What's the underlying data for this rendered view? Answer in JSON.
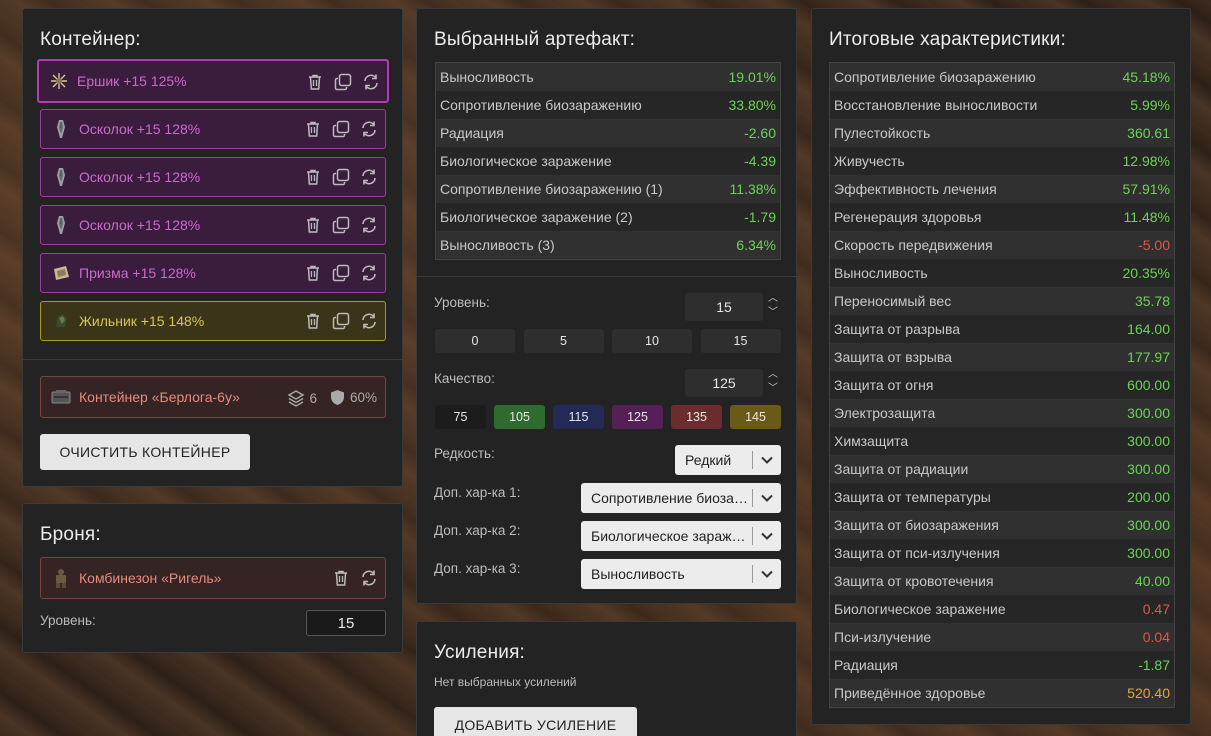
{
  "container": {
    "title": "Контейнер:",
    "slots": [
      {
        "label": "Ершик +15 125%",
        "icon": "erzhik-artifact-icon",
        "color": "purple"
      },
      {
        "label": "Осколок +15 128%",
        "icon": "oskolok-artifact-icon",
        "color": "purple"
      },
      {
        "label": "Осколок +15 128%",
        "icon": "oskolok-artifact-icon",
        "color": "purple"
      },
      {
        "label": "Осколок +15 128%",
        "icon": "oskolok-artifact-icon",
        "color": "purple"
      },
      {
        "label": "Призма +15 128%",
        "icon": "prizma-artifact-icon",
        "color": "purple"
      },
      {
        "label": "Жильник +15 148%",
        "icon": "zhilnik-artifact-icon",
        "color": "yellow"
      }
    ],
    "item": {
      "label": "Контейнер «Берлога-6у»",
      "slots": "6",
      "protection": "60%"
    },
    "clear_button": "ОЧИСТИТЬ КОНТЕЙНЕР"
  },
  "armor": {
    "title": "Броня:",
    "item_label": "Комбинезон «Ригель»",
    "level_label": "Уровень:",
    "level_value": "15"
  },
  "artifact": {
    "title": "Выбранный артефакт:",
    "stats": [
      {
        "name": "Выносливость",
        "value": "19.01%",
        "tone": "pos"
      },
      {
        "name": "Сопротивление биозаражению",
        "value": "33.80%",
        "tone": "pos"
      },
      {
        "name": "Радиация",
        "value": "-2.60",
        "tone": "pos"
      },
      {
        "name": "Биологическое заражение",
        "value": "-4.39",
        "tone": "pos"
      },
      {
        "name": "Сопротивление биозаражению (1)",
        "value": "11.38%",
        "tone": "pos"
      },
      {
        "name": "Биологическое заражение (2)",
        "value": "-1.79",
        "tone": "pos"
      },
      {
        "name": "Выносливость (3)",
        "value": "6.34%",
        "tone": "pos"
      }
    ],
    "level_label": "Уровень:",
    "level_value": "15",
    "level_presets": [
      "0",
      "5",
      "10",
      "15"
    ],
    "quality_label": "Качество:",
    "quality_value": "125",
    "quality_presets": [
      {
        "label": "75",
        "color": "#1c1c1c"
      },
      {
        "label": "105",
        "color": "#2f6b2f"
      },
      {
        "label": "115",
        "color": "#222a55"
      },
      {
        "label": "125",
        "color": "#552055"
      },
      {
        "label": "135",
        "color": "#6a2c2c"
      },
      {
        "label": "145",
        "color": "#6a5a18"
      }
    ],
    "rarity_label": "Редкость:",
    "rarity_value": "Редкий",
    "extra1_label": "Доп. хар-ка 1:",
    "extra1_value": "Сопротивление биозаражению",
    "extra2_label": "Доп. хар-ка 2:",
    "extra2_value": "Биологическое заражение",
    "extra3_label": "Доп. хар-ка 3:",
    "extra3_value": "Выносливость"
  },
  "boosts": {
    "title": "Усиления:",
    "empty_text": "Нет выбранных усилений",
    "add_button": "ДОБАВИТЬ УСИЛЕНИЕ"
  },
  "totals": {
    "title": "Итоговые характеристики:",
    "stats": [
      {
        "name": "Сопротивление биозаражению",
        "value": "45.18%",
        "tone": "pos"
      },
      {
        "name": "Восстановление выносливости",
        "value": "5.99%",
        "tone": "pos"
      },
      {
        "name": "Пулестойкость",
        "value": "360.61",
        "tone": "pos"
      },
      {
        "name": "Живучесть",
        "value": "12.98%",
        "tone": "pos"
      },
      {
        "name": "Эффективность лечения",
        "value": "57.91%",
        "tone": "pos"
      },
      {
        "name": "Регенерация здоровья",
        "value": "11.48%",
        "tone": "pos"
      },
      {
        "name": "Скорость передвижения",
        "value": "-5.00",
        "tone": "neg"
      },
      {
        "name": "Выносливость",
        "value": "20.35%",
        "tone": "pos"
      },
      {
        "name": "Переносимый вес",
        "value": "35.78",
        "tone": "pos"
      },
      {
        "name": "Защита от разрыва",
        "value": "164.00",
        "tone": "pos"
      },
      {
        "name": "Защита от взрыва",
        "value": "177.97",
        "tone": "pos"
      },
      {
        "name": "Защита от огня",
        "value": "600.00",
        "tone": "pos"
      },
      {
        "name": "Электрозащита",
        "value": "300.00",
        "tone": "pos"
      },
      {
        "name": "Химзащита",
        "value": "300.00",
        "tone": "pos"
      },
      {
        "name": "Защита от радиации",
        "value": "300.00",
        "tone": "pos"
      },
      {
        "name": "Защита от температуры",
        "value": "200.00",
        "tone": "pos"
      },
      {
        "name": "Защита от биозаражения",
        "value": "300.00",
        "tone": "pos"
      },
      {
        "name": "Защита от пси-излучения",
        "value": "300.00",
        "tone": "pos"
      },
      {
        "name": "Защита от кровотечения",
        "value": "40.00",
        "tone": "pos"
      },
      {
        "name": "Биологическое заражение",
        "value": "0.47",
        "tone": "neg"
      },
      {
        "name": "Пси-излучение",
        "value": "0.04",
        "tone": "neg"
      },
      {
        "name": "Радиация",
        "value": "-1.87",
        "tone": "pos"
      },
      {
        "name": "Приведённое здоровье",
        "value": "520.40",
        "tone": "gold"
      }
    ]
  }
}
